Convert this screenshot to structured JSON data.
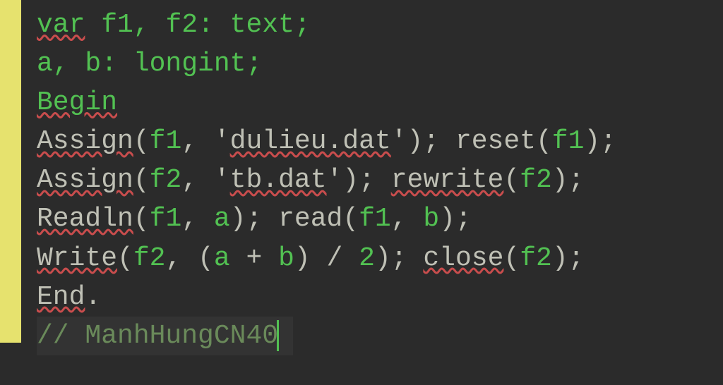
{
  "code": {
    "line1_var": "var",
    "line1_rest": " f1, f2: text;",
    "line2": "a, b: longint;",
    "line3_begin": "Begin",
    "line4_assign": "Assign",
    "line4_p1": "(",
    "line4_f1": "f1",
    "line4_c1": ", '",
    "line4_str": "dulieu.dat",
    "line4_c2": "'); ",
    "line4_reset": "reset",
    "line4_p2": "(",
    "line4_f1b": "f1",
    "line4_p3": ");",
    "line5_assign": "Assign",
    "line5_p1": "(",
    "line5_f2": "f2",
    "line5_c1": ", '",
    "line5_str": "tb.dat",
    "line5_c2": "'); ",
    "line5_rewrite": "rewrite",
    "line5_p2": "(",
    "line5_f2b": "f2",
    "line5_p3": ");",
    "line6_readln": "Readln",
    "line6_p1": "(",
    "line6_f1": "f1",
    "line6_c1": ", ",
    "line6_a": "a",
    "line6_p2": "); ",
    "line6_read": "read",
    "line6_p3": "(",
    "line6_f1b": "f1",
    "line6_c2": ", ",
    "line6_b": "b",
    "line6_p4": ");",
    "line7_write": "Write",
    "line7_p1": "(",
    "line7_f2": "f2",
    "line7_c1": ", (",
    "line7_a": "a",
    "line7_plus": " + ",
    "line7_b": "b",
    "line7_c2": ") / ",
    "line7_two": "2",
    "line7_p2": "); ",
    "line7_close": "close",
    "line7_p3": "(",
    "line7_f2b": "f2",
    "line7_p4": ");",
    "line8_end": "End",
    "line8_dot": ".",
    "line9_comment": "// ManhHungCN40"
  }
}
